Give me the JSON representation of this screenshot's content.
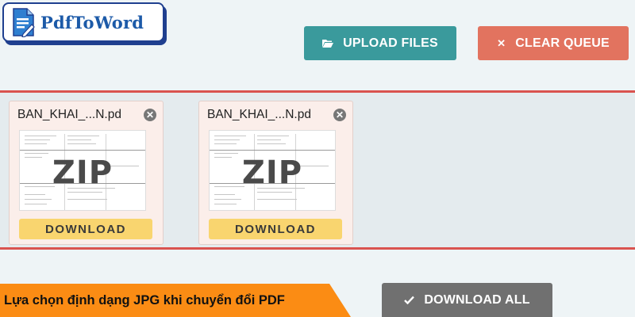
{
  "logo": {
    "text": "PdfToWord",
    "icon": "document-pen-icon"
  },
  "toolbar": {
    "upload_label": "UPLOAD FILES",
    "upload_icon": "folder-open-icon",
    "clear_label": "CLEAR QUEUE",
    "clear_icon": "close-icon"
  },
  "files": [
    {
      "name": "BAN_KHAI_...N.pd",
      "thumbnail_label": "ZIP",
      "download_label": "DOWNLOAD"
    },
    {
      "name": "BAN_KHAI_...N.pd",
      "thumbnail_label": "ZIP",
      "download_label": "DOWNLOAD"
    }
  ],
  "footer": {
    "download_all_label": "DOWNLOAD ALL",
    "download_all_icon": "checkmark-icon",
    "caption": "Lựa chọn định dạng JPG khi chuyển đổi PDF"
  },
  "colors": {
    "upload": "#3a9a9c",
    "clear": "#e2735f",
    "queue_border": "#d9534f",
    "download": "#f9d56f",
    "download_all": "#707070",
    "caption_bg": "#fb8c14",
    "logo_blue": "#1c5aa8"
  }
}
